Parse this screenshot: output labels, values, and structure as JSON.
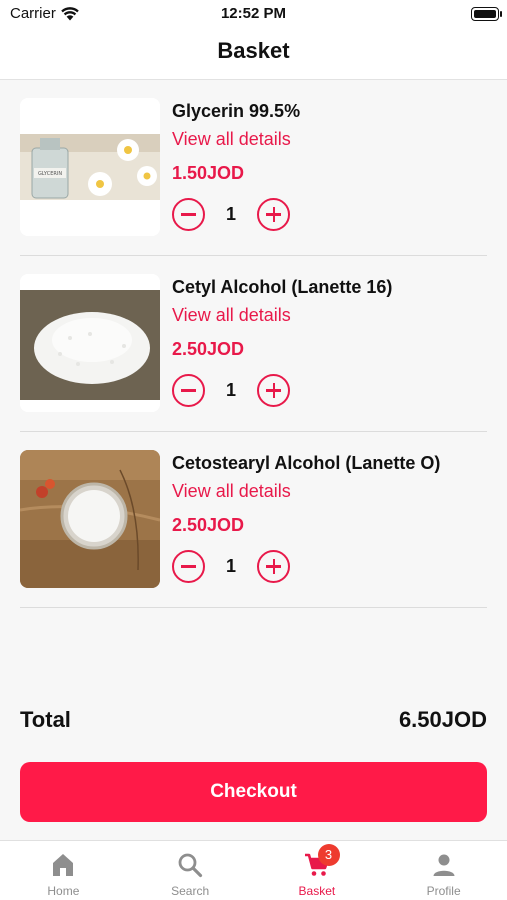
{
  "status_bar": {
    "carrier": "Carrier",
    "time": "12:52 PM"
  },
  "header": {
    "title": "Basket"
  },
  "items": [
    {
      "name": "Glycerin 99.5%",
      "link": "View all details",
      "price": "1.50JOD",
      "quantity": "1",
      "image": "glycerin-bottle-photo"
    },
    {
      "name": "Cetyl Alcohol (Lanette 16)",
      "link": "View all details",
      "price": "2.50JOD",
      "quantity": "1",
      "image": "white-pellets-photo"
    },
    {
      "name": "Cetostearyl Alcohol (Lanette O)",
      "link": "View all details",
      "price": "2.50JOD",
      "quantity": "1",
      "image": "white-powder-bowl-photo"
    }
  ],
  "summary": {
    "total_label": "Total",
    "total_value": "6.50JOD"
  },
  "checkout": {
    "label": "Checkout"
  },
  "tabs": [
    {
      "label": "Home",
      "icon": "home-icon",
      "active": false
    },
    {
      "label": "Search",
      "icon": "search-icon",
      "active": false
    },
    {
      "label": "Basket",
      "icon": "cart-icon",
      "active": true,
      "badge": "3"
    },
    {
      "label": "Profile",
      "icon": "person-icon",
      "active": false
    }
  ],
  "colors": {
    "accent": "#e8194a",
    "button": "#ff1a48",
    "badge": "#ee3b2f",
    "tab_inactive": "#8e8e8e"
  }
}
